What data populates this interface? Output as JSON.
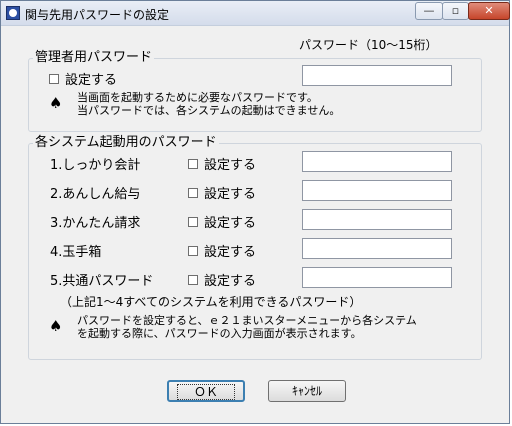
{
  "window": {
    "title": "関与先用パスワードの設定",
    "min_glyph": "—",
    "max_glyph": "▫",
    "close_glyph": "✕"
  },
  "header": {
    "password_hint": "パスワード（10～15桁）"
  },
  "admin_group": {
    "title": "管理者用パスワード",
    "checkbox_label": "設定する",
    "password_value": "",
    "note_mark": "♠",
    "note_line1": "当画面を起動するために必要なパスワードです。",
    "note_line2": "当パスワードでは、各システムの起動はできません。"
  },
  "system_group": {
    "title": "各システム起動用のパスワード",
    "rows": [
      {
        "label": "1.しっかり会計",
        "checkbox_label": "設定する",
        "password_value": ""
      },
      {
        "label": "2.あんしん給与",
        "checkbox_label": "設定する",
        "password_value": ""
      },
      {
        "label": "3.かんたん請求",
        "checkbox_label": "設定する",
        "password_value": ""
      },
      {
        "label": "4.玉手箱",
        "checkbox_label": "設定する",
        "password_value": ""
      },
      {
        "label": "5.共通パスワード",
        "checkbox_label": "設定する",
        "password_value": ""
      }
    ],
    "common_note": "（上記1～4すべてのシステムを利用できるパスワード）",
    "note_mark": "♠",
    "note_line1": "パスワードを設定すると、ｅ２１まいスターメニューから各システム",
    "note_line2": "を起動する際に、パスワードの入力画面が表示されます。"
  },
  "buttons": {
    "ok": "ＯＫ",
    "cancel": "ｷｬﾝｾﾙ"
  }
}
